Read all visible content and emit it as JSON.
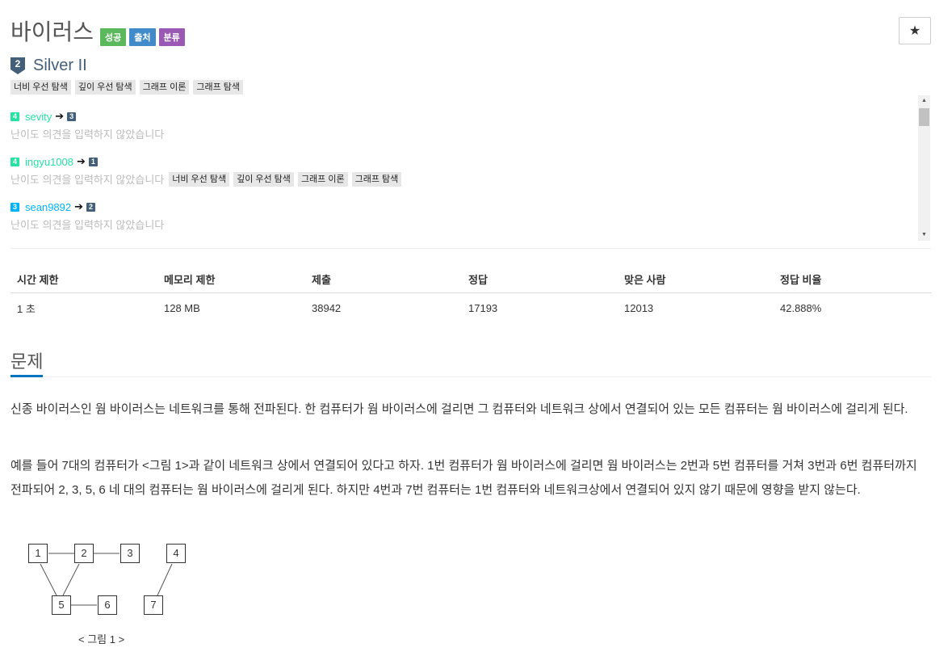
{
  "problem": {
    "title": "바이러스",
    "badges": [
      {
        "label": "성공",
        "color": "#5cb85c"
      },
      {
        "label": "출처",
        "color": "#428bca"
      },
      {
        "label": "분류",
        "color": "#9b59b6"
      }
    ],
    "star_label": "★",
    "tier": {
      "number": "2",
      "label": "Silver II",
      "color": "#435f7a"
    },
    "tags": [
      "너비 우선 탐색",
      "깊이 우선 탐색",
      "그래프 이론",
      "그래프 탐색"
    ]
  },
  "opinions": [
    {
      "from_tier": "4",
      "from_color": "#27e2a4",
      "user": "sevity",
      "user_color": "#27e2a4",
      "to_tier": "3",
      "to_color": "#435f7a",
      "text": "난이도 의견을 입력하지 않았습니다",
      "tags": []
    },
    {
      "from_tier": "4",
      "from_color": "#27e2a4",
      "user": "ingyu1008",
      "user_color": "#27e2a4",
      "to_tier": "1",
      "to_color": "#435f7a",
      "text": "난이도 의견을 입력하지 않았습니다",
      "tags": [
        "너비 우선 탐색",
        "깊이 우선 탐색",
        "그래프 이론",
        "그래프 탐색"
      ]
    },
    {
      "from_tier": "3",
      "from_color": "#00b4fc",
      "user": "sean9892",
      "user_color": "#00b4fc",
      "to_tier": "2",
      "to_color": "#435f7a",
      "text": "난이도 의견을 입력하지 않았습니다",
      "tags": []
    }
  ],
  "stats": {
    "headers": [
      "시간 제한",
      "메모리 제한",
      "제출",
      "정답",
      "맞은 사람",
      "정답 비율"
    ],
    "values": [
      "1 초",
      "128 MB",
      "38942",
      "17193",
      "12013",
      "42.888%"
    ]
  },
  "section": {
    "title": "문제",
    "paragraphs": [
      "신종 바이러스인 웜 바이러스는 네트워크를 통해 전파된다. 한 컴퓨터가 웜 바이러스에 걸리면 그 컴퓨터와 네트워크 상에서 연결되어 있는 모든 컴퓨터는 웜 바이러스에 걸리게 된다.",
      "예를 들어 7대의 컴퓨터가 <그림 1>과 같이 네트워크 상에서 연결되어 있다고 하자. 1번 컴퓨터가 웜 바이러스에 걸리면 웜 바이러스는 2번과 5번 컴퓨터를 거쳐 3번과 6번 컴퓨터까지 전파되어 2, 3, 5, 6 네 대의 컴퓨터는 웜 바이러스에 걸리게 된다. 하지만 4번과 7번 컴퓨터는 1번 컴퓨터와 네트워크상에서 연결되어 있지 않기 때문에 영향을 받지 않는다."
    ],
    "figure": {
      "nodes": [
        "1",
        "2",
        "3",
        "4",
        "5",
        "6",
        "7"
      ],
      "caption": "< 그림 1 >"
    }
  }
}
